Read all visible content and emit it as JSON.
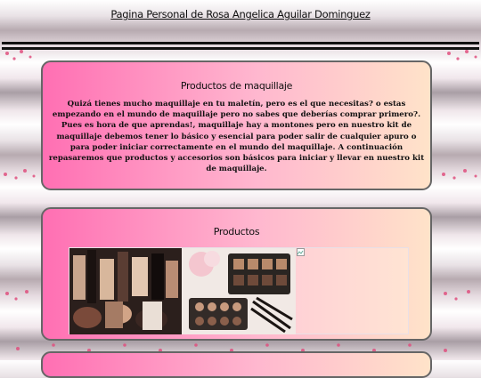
{
  "page": {
    "title": "Pagina Personal de Rosa Angelica Aguilar Dominguez"
  },
  "sections": [
    {
      "title": "Productos de maquillaje",
      "body": "Quizá tienes mucho maquillaje en tu maletín, pero es el que necesitas? o estas empezando en el mundo de maquillaje pero no sabes que deberías comprar primero?. Pues es hora de que aprendas!, maquillaje hay a montones pero en nuestro kit de maquillaje debemos tener lo básico y esencial para poder salir de cualquier apuro o para poder iniciar correctamente en el mundo del maquillaje. A continuación repasaremos que productos y accesorios son básicos para iniciar y llevar en nuestro kit de maquillaje."
    },
    {
      "title": "Productos"
    }
  ],
  "gallery": {
    "images": [
      {
        "icon": "makeup-collection-photo"
      },
      {
        "icon": "makeup-palette-brushes-photo"
      },
      {
        "icon": "broken-image-icon"
      }
    ]
  },
  "colors": {
    "card_gradient_start": "#ff6fb3",
    "card_gradient_mid": "#ffb7cf",
    "card_gradient_end": "#ffe3c9",
    "card_border": "#666666",
    "rule": "#111111"
  }
}
